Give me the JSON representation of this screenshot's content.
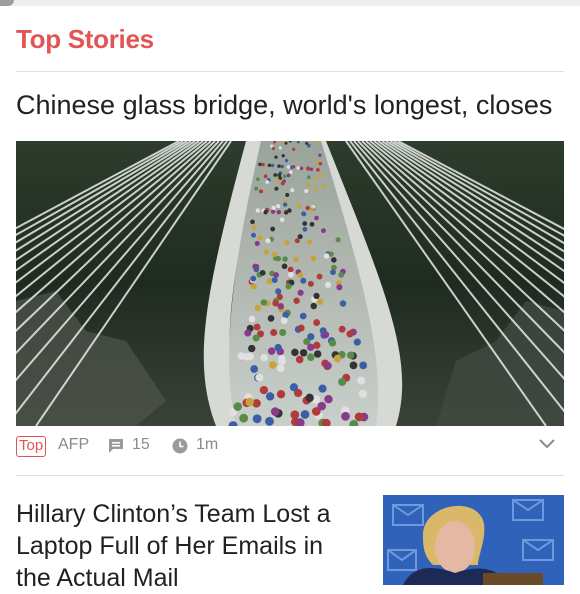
{
  "section": {
    "title": "Top Stories"
  },
  "story1": {
    "headline": "Chinese glass bridge, world's longest, closes",
    "tag": "Top",
    "source": "AFP",
    "comments": "15",
    "time": "1m",
    "image_icon": "glass-bridge-photo"
  },
  "story2": {
    "headline": "Hillary Clinton’s Team Lost a Laptop Full of Her Emails in the Actual Mail",
    "image_icon": "clinton-photo"
  },
  "icons": {
    "comment": "comment-icon",
    "clock": "clock-icon",
    "expand": "chevron-down-icon"
  },
  "colors": {
    "accent": "#e25555",
    "meta_text": "#8a8a8a",
    "divider": "#e0e0e0"
  }
}
